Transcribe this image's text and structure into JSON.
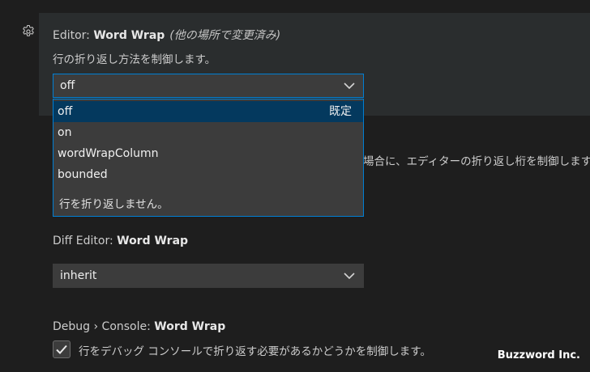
{
  "word_wrap": {
    "category": "Editor: ",
    "key": "Word Wrap",
    "modified": "(他の場所で変更済み)",
    "description": "行の折り返し方法を制御します。",
    "value": "off",
    "dropdown": {
      "options": [
        {
          "label": "off",
          "tag": "既定"
        },
        {
          "label": "on"
        },
        {
          "label": "wordWrapColumn"
        },
        {
          "label": "bounded"
        }
      ],
      "option_description": "行を折り返しません。"
    }
  },
  "partially_hidden_description": "場合に、エディターの折り返し桁を制御します。",
  "diff_word_wrap": {
    "category": "Diff Editor: ",
    "key": "Word Wrap",
    "value": "inherit"
  },
  "debug_console_word_wrap": {
    "category": "Debug › Console: ",
    "key": "Word Wrap",
    "checked": true,
    "description": "行をデバッグ コンソールで折り返す必要があるかどうかを制御します。"
  },
  "watermark": "Buzzword Inc.",
  "icons": {
    "gear": "gear-icon",
    "chevron": "chevron-down-icon",
    "check": "check-icon"
  },
  "colors": {
    "background": "#1e1e1e",
    "highlight": "#2a2d2e",
    "input_bg": "#3c3c3c",
    "focus_border": "#007fd4",
    "selected_option": "#04395e"
  }
}
